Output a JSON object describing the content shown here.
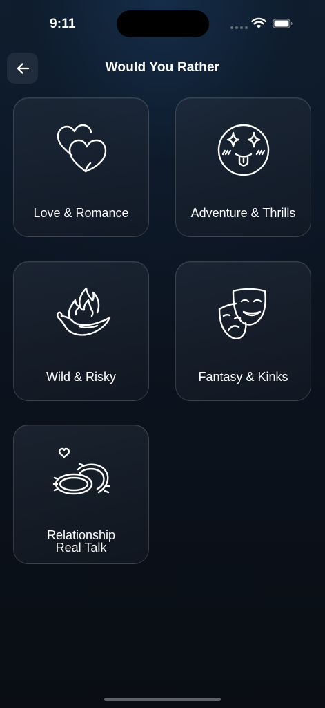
{
  "status_bar": {
    "time": "9:11"
  },
  "header": {
    "title": "Would You Rather",
    "back_icon": "arrow-left-icon"
  },
  "categories": [
    {
      "label": "Love & Romance",
      "icon": "two-hearts-icon"
    },
    {
      "label": "Adventure & Thrills",
      "icon": "starry-eyed-face-icon"
    },
    {
      "label": "Wild & Risky",
      "icon": "flaming-pepper-icon"
    },
    {
      "label": "Fantasy & Kinks",
      "icon": "theater-masks-icon"
    },
    {
      "label_lines": [
        "Relationship",
        "Real Talk"
      ],
      "icon": "rings-heart-icon"
    }
  ],
  "colors": {
    "background": "#0b0f15",
    "card_border": "rgba(255,255,255,0.16)",
    "text": "#ffffff"
  }
}
